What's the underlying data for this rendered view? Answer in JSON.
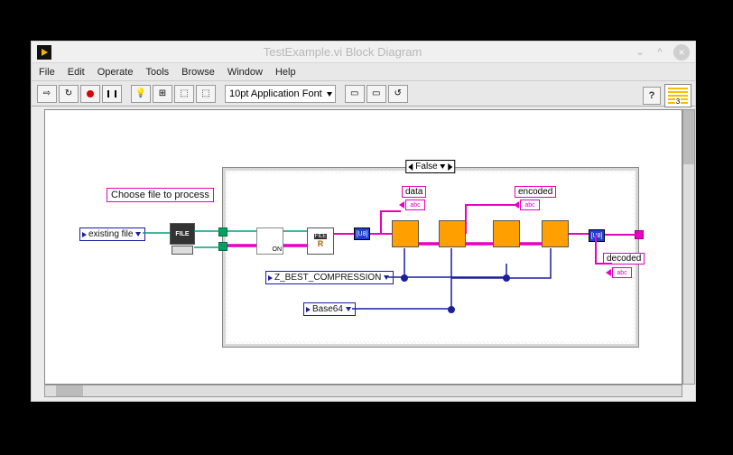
{
  "window": {
    "title": "TestExample.vi Block Diagram"
  },
  "menu": {
    "file": "File",
    "edit": "Edit",
    "operate": "Operate",
    "tools": "Tools",
    "browse": "Browse",
    "window": "Window",
    "help": "Help"
  },
  "toolbar": {
    "font": "10pt Application Font",
    "help": "?",
    "vi_num": "3"
  },
  "diagram": {
    "case_selector": "False",
    "labels": {
      "choose_file": "Choose file to process",
      "data": "data",
      "encoded": "encoded",
      "decoded": "decoded"
    },
    "constants": {
      "existing_file": "existing file",
      "compression": "Z_BEST_COMPRESSION",
      "base64": "Base64"
    },
    "str_ind_text": "abc",
    "to_u8": "[U8]",
    "auto_node": "ON"
  }
}
